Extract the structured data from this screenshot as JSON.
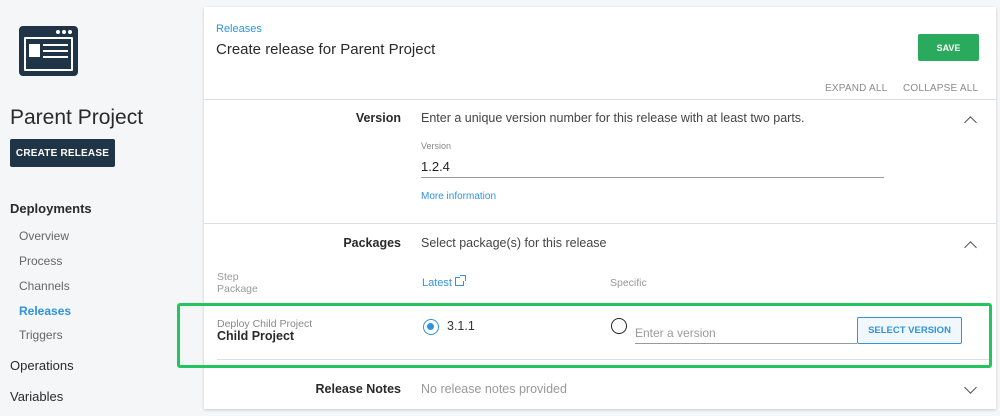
{
  "sidebar": {
    "project_title": "Parent Project",
    "create_release_label": "CREATE RELEASE",
    "deployments_label": "Deployments",
    "items": [
      {
        "label": "Overview"
      },
      {
        "label": "Process"
      },
      {
        "label": "Channels"
      },
      {
        "label": "Releases",
        "active": true
      },
      {
        "label": "Triggers"
      }
    ],
    "operations_label": "Operations",
    "variables_label": "Variables"
  },
  "header": {
    "breadcrumb": "Releases",
    "title": "Create release for Parent Project",
    "save_label": "SAVE",
    "expand_all_label": "EXPAND ALL",
    "collapse_all_label": "COLLAPSE ALL"
  },
  "version_section": {
    "label": "Version",
    "description": "Enter a unique version number for this release with at least two parts.",
    "field_label": "Version",
    "value": "1.2.4",
    "more_info": "More information"
  },
  "packages_section": {
    "label": "Packages",
    "description": "Select package(s) for this release",
    "col_step": "Step",
    "col_package": "Package",
    "col_latest": "Latest",
    "col_specific": "Specific",
    "rows": [
      {
        "step": "Deploy Child Project",
        "package": "Child Project",
        "latest_version": "3.1.1",
        "specific_placeholder": "Enter a version",
        "select_version_label": "SELECT VERSION"
      }
    ]
  },
  "notes_section": {
    "label": "Release Notes",
    "description": "No release notes provided"
  },
  "colors": {
    "accent": "#2f93e0",
    "save_green": "#2aaa5d",
    "highlight_green": "#22c55e",
    "navy": "#1f3547"
  },
  "icons": [
    "app-logo-icon",
    "chevron-up-icon",
    "chevron-down-icon",
    "external-link-icon",
    "radio-icon"
  ]
}
